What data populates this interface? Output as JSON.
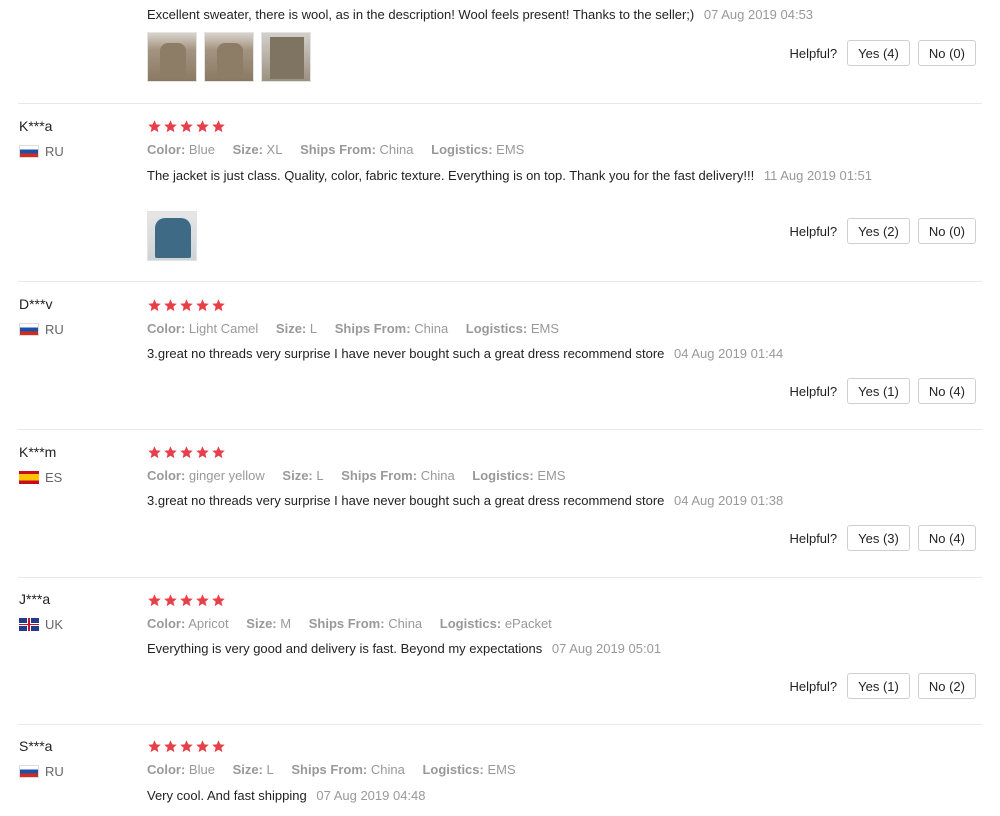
{
  "reviews": [
    {
      "comment": "Excellent sweater, there is wool, as in the description! Wool feels present! Thanks to the seller;)",
      "date": "07 Aug 2019 04:53",
      "helpful_label": "Helpful?",
      "yes": "Yes (4)",
      "no": "No (0)",
      "photos": [
        "photo-tan",
        "photo-tan",
        "photo-grey"
      ]
    },
    {
      "user": "K***a",
      "country": "RU",
      "rating": 5,
      "color_label": "Color:",
      "color": "Blue",
      "size_label": "Size:",
      "size": "XL",
      "ships_label": "Ships From:",
      "ships": "China",
      "logistics_label": "Logistics:",
      "logistics": "EMS",
      "comment": "The jacket is just class. Quality, color, fabric texture. Everything is on top. Thank you for the fast delivery!!!",
      "date": "11 Aug 2019 01:51",
      "helpful_label": "Helpful?",
      "yes": "Yes (2)",
      "no": "No (0)",
      "photos": [
        "photo-blue"
      ]
    },
    {
      "user": "D***v",
      "country": "RU",
      "rating": 5,
      "color_label": "Color:",
      "color": "Light Camel",
      "size_label": "Size:",
      "size": "L",
      "ships_label": "Ships From:",
      "ships": "China",
      "logistics_label": "Logistics:",
      "logistics": "EMS",
      "comment": "3.great no threads very surprise I have never bought such a great dress recommend store",
      "date": "04 Aug 2019 01:44",
      "helpful_label": "Helpful?",
      "yes": "Yes (1)",
      "no": "No (4)"
    },
    {
      "user": "K***m",
      "country": "ES",
      "rating": 5,
      "color_label": "Color:",
      "color": "ginger yellow",
      "size_label": "Size:",
      "size": "L",
      "ships_label": "Ships From:",
      "ships": "China",
      "logistics_label": "Logistics:",
      "logistics": "EMS",
      "comment": "3.great no threads very surprise I have never bought such a great dress recommend store",
      "date": "04 Aug 2019 01:38",
      "helpful_label": "Helpful?",
      "yes": "Yes (3)",
      "no": "No (4)"
    },
    {
      "user": "J***a",
      "country": "UK",
      "rating": 5,
      "color_label": "Color:",
      "color": "Apricot",
      "size_label": "Size:",
      "size": "M",
      "ships_label": "Ships From:",
      "ships": "China",
      "logistics_label": "Logistics:",
      "logistics": "ePacket",
      "comment": "Everything is very good and delivery is fast. Beyond my expectations",
      "date": "07 Aug 2019 05:01",
      "helpful_label": "Helpful?",
      "yes": "Yes (1)",
      "no": "No (2)"
    },
    {
      "user": "S***a",
      "country": "RU",
      "rating": 5,
      "color_label": "Color:",
      "color": "Blue",
      "size_label": "Size:",
      "size": "L",
      "ships_label": "Ships From:",
      "ships": "China",
      "logistics_label": "Logistics:",
      "logistics": "EMS",
      "comment": "Very cool. And fast shipping",
      "date": "07 Aug 2019 04:48"
    }
  ],
  "colors": {
    "star": "#e8404b",
    "divider": "#e8e8e8",
    "muted": "#999999"
  }
}
